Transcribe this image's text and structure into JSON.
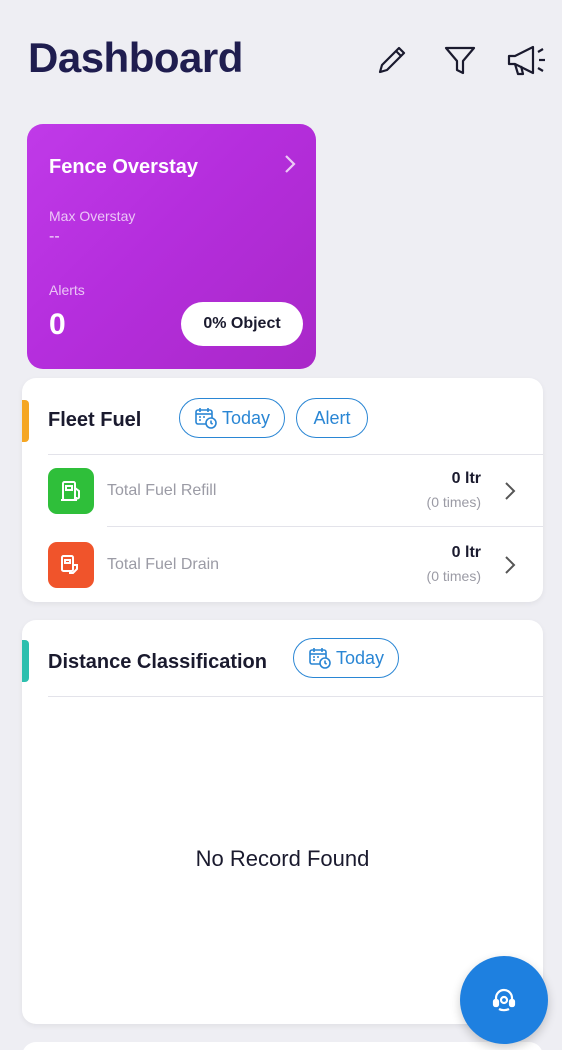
{
  "header": {
    "title": "Dashboard",
    "icons": [
      "pencil-icon",
      "filter-icon",
      "megaphone-icon"
    ]
  },
  "fence_overstay": {
    "title": "Fence Overstay",
    "max_overstay_label": "Max Overstay",
    "max_overstay_value": "--",
    "alerts_label": "Alerts",
    "alerts_value": "0",
    "object_pill": "0% Object",
    "gradient_colors": [
      "#c03ae8",
      "#a928c8"
    ]
  },
  "fleet_fuel": {
    "title": "Fleet Fuel",
    "accent_color": "#f5a623",
    "today_label": "Today",
    "alert_label": "Alert",
    "rows": [
      {
        "icon": "fuel-pump-icon",
        "icon_color": "#2fbf3a",
        "label": "Total Fuel Refill",
        "value": "0 ltr",
        "sub": "(0 times)"
      },
      {
        "icon": "fuel-drain-icon",
        "icon_color": "#f0542b",
        "label": "Total Fuel Drain",
        "value": "0 ltr",
        "sub": "(0 times)"
      }
    ]
  },
  "distance_classification": {
    "title": "Distance Classification",
    "accent_color": "#2dbfae",
    "today_label": "Today",
    "empty_text": "No Record Found"
  },
  "fab": {
    "icon": "support-agent-icon",
    "color": "#1e80e0"
  },
  "theme": {
    "accent_blue": "#2a86d4",
    "title_color": "#1f1d4f",
    "background": "#eeeef3"
  }
}
